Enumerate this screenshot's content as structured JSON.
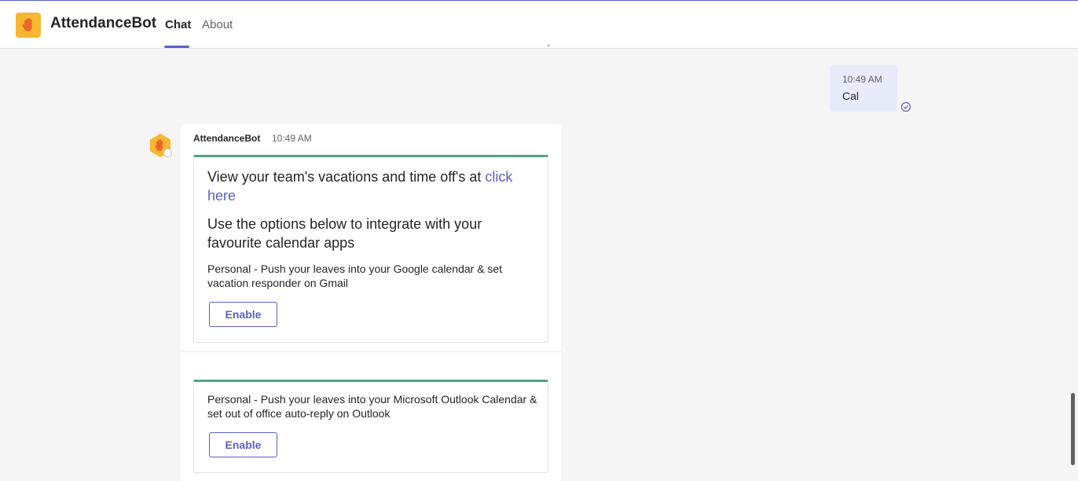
{
  "header": {
    "app_title": "AttendanceBot",
    "tabs": [
      {
        "label": "Chat",
        "active": true
      },
      {
        "label": "About",
        "active": false
      }
    ]
  },
  "my_message": {
    "time": "10:49 AM",
    "text": "Cal"
  },
  "bot_message": {
    "sender": "AttendanceBot",
    "time": "10:49 AM",
    "card1": {
      "line1_text": "View your team's vacations and time off's at ",
      "line1_link": "click",
      "line1_link_cont": "here",
      "line2": "Use the options below to integrate with your favourite calendar apps",
      "personal_google": "Personal - Push your leaves into your Google calendar & set vacation responder on Gmail",
      "button_label": "Enable"
    },
    "card2": {
      "personal_outlook": "Personal - Push your leaves into your Microsoft Outlook Calendar & set out of office auto-reply on Outlook",
      "button_label": "Enable"
    }
  },
  "colors": {
    "accent": "#5b5fc7",
    "card_top_border": "#4fa38a",
    "app_icon_bg": "#f7b731",
    "my_bubble_bg": "#e8ebfa"
  },
  "icons": [
    "raised-hand-icon",
    "read-receipt-icon",
    "chevron-down-icon"
  ]
}
